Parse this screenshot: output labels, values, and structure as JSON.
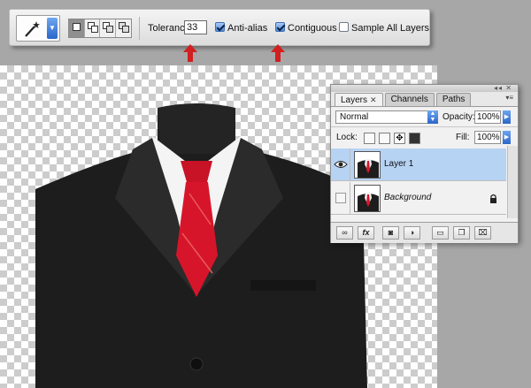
{
  "options_bar": {
    "tolerance_label": "Tolerance:",
    "tolerance_value": "33",
    "anti_alias_label": "Anti-alias",
    "anti_alias_checked": true,
    "contiguous_label": "Contiguous",
    "contiguous_checked": true,
    "sample_all_layers_label": "Sample All Layers",
    "sample_all_layers_checked": false,
    "tool_icon": "magic-wand-icon",
    "selection_modes": [
      "new-selection",
      "add-to-selection",
      "subtract-from-selection",
      "intersect-with-selection"
    ],
    "active_selection_mode": "new-selection"
  },
  "annotations": {
    "arrow_color": "#d21f1f",
    "arrow_targets": [
      "tolerance",
      "contiguous"
    ]
  },
  "layers_panel": {
    "tabs": [
      {
        "label": "Layers",
        "active": true
      },
      {
        "label": "Channels",
        "active": false
      },
      {
        "label": "Paths",
        "active": false
      }
    ],
    "blend_mode": "Normal",
    "opacity_label": "Opacity:",
    "opacity_value": "100%",
    "lock_label": "Lock:",
    "fill_label": "Fill:",
    "fill_value": "100%",
    "layers": [
      {
        "name": "Layer 1",
        "visible": true,
        "selected": true,
        "locked": false
      },
      {
        "name": "Background",
        "visible": false,
        "selected": false,
        "locked": true
      }
    ],
    "footer_buttons": [
      "link-layers",
      "fx",
      "add-mask",
      "adjustment-layer",
      "new-group",
      "new-layer",
      "delete-layer"
    ],
    "fx_label": "fx"
  },
  "colors": {
    "selection_highlight": "#b7d3f4",
    "suit": "#1c1c1c",
    "tie": "#d7152a",
    "shirt": "#f4f4f4"
  }
}
